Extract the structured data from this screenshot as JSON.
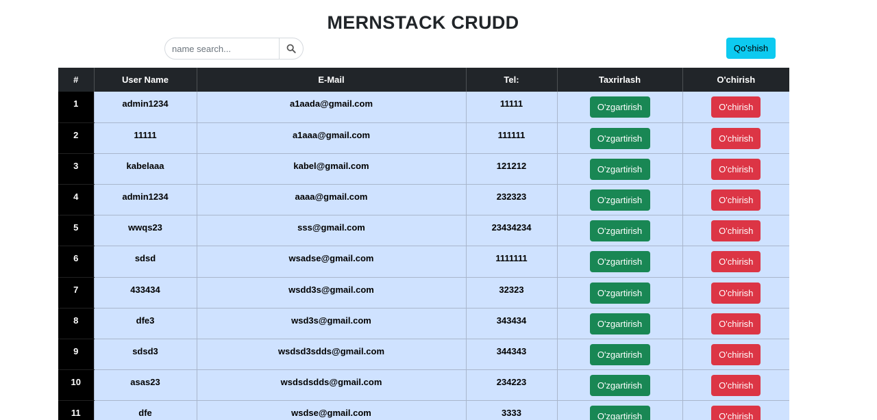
{
  "header": {
    "title": "MERNSTACK CRUDD"
  },
  "search": {
    "placeholder": "name search...",
    "value": "",
    "icon": "search-icon"
  },
  "toolbar": {
    "add_label": "Qo'shish"
  },
  "table": {
    "columns": [
      "#",
      "User Name",
      "E-Mail",
      "Tel:",
      "Taxrirlash",
      "O'chirish"
    ],
    "edit_label": "O'zgartirish",
    "delete_label": "O'chirish",
    "rows": [
      {
        "num": "1",
        "name": "admin1234",
        "email": "a1aada@gmail.com",
        "tel": "11111"
      },
      {
        "num": "2",
        "name": "11111",
        "email": "a1aaa@gmail.com",
        "tel": "111111"
      },
      {
        "num": "3",
        "name": "kabelaaa",
        "email": "kabel@gmail.com",
        "tel": "121212"
      },
      {
        "num": "4",
        "name": "admin1234",
        "email": "aaaa@gmail.com",
        "tel": "232323"
      },
      {
        "num": "5",
        "name": "wwqs23",
        "email": "sss@gmail.com",
        "tel": "23434234"
      },
      {
        "num": "6",
        "name": "sdsd",
        "email": "wsadse@gmail.com",
        "tel": "1111111"
      },
      {
        "num": "7",
        "name": "433434",
        "email": "wsdd3s@gmail.com",
        "tel": "32323"
      },
      {
        "num": "8",
        "name": "dfe3",
        "email": "wsd3s@gmail.com",
        "tel": "343434"
      },
      {
        "num": "9",
        "name": "sdsd3",
        "email": "wsdsd3sdds@gmail.com",
        "tel": "344343"
      },
      {
        "num": "10",
        "name": "asas23",
        "email": "wsdsdsdds@gmail.com",
        "tel": "234223"
      },
      {
        "num": "11",
        "name": "dfe",
        "email": "wsdse@gmail.com",
        "tel": "3333"
      }
    ]
  },
  "colors": {
    "header_bg": "#212529",
    "row_bg": "#cfe2ff",
    "add_button": "#0dcaf0",
    "edit_button": "#198754",
    "delete_button": "#dc3545"
  }
}
